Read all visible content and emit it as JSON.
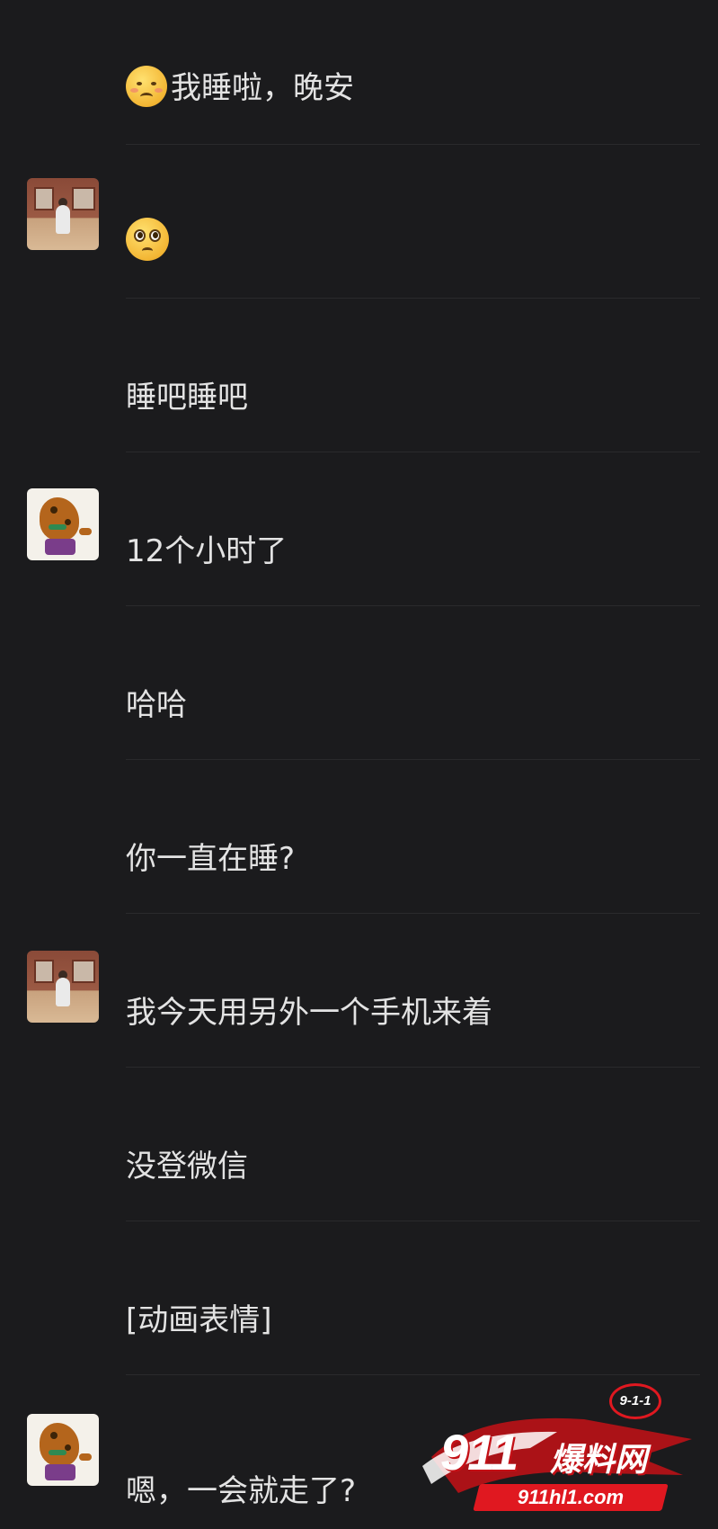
{
  "messages": [
    {
      "text": "我睡啦，晚安",
      "emoji": "tired-face-emoji",
      "avatar": null
    },
    {
      "text": "",
      "emoji": "pleading-face-emoji",
      "avatar": "room-photo-avatar"
    },
    {
      "text": "睡吧睡吧",
      "emoji": null,
      "avatar": null
    },
    {
      "text": "12个小时了",
      "emoji": null,
      "avatar": "scooby-doo-avatar"
    },
    {
      "text": "哈哈",
      "emoji": null,
      "avatar": null
    },
    {
      "text": "你一直在睡?",
      "emoji": null,
      "avatar": null
    },
    {
      "text": "我今天用另外一个手机来着",
      "emoji": null,
      "avatar": "room-photo-avatar"
    },
    {
      "text": "没登微信",
      "emoji": null,
      "avatar": null
    },
    {
      "text": "[动画表情]",
      "emoji": null,
      "avatar": null
    },
    {
      "text": "嗯，一会就走了?",
      "emoji": null,
      "avatar": "scooby-doo-avatar"
    }
  ],
  "watermark": {
    "badge": "9-1-1",
    "number": "911",
    "name": "爆料网",
    "url": "911hl1.com",
    "brand_color": "#e01820"
  },
  "colors": {
    "background": "#1b1b1d",
    "text": "#e3e3e3",
    "divider": "#2a2a2c"
  }
}
